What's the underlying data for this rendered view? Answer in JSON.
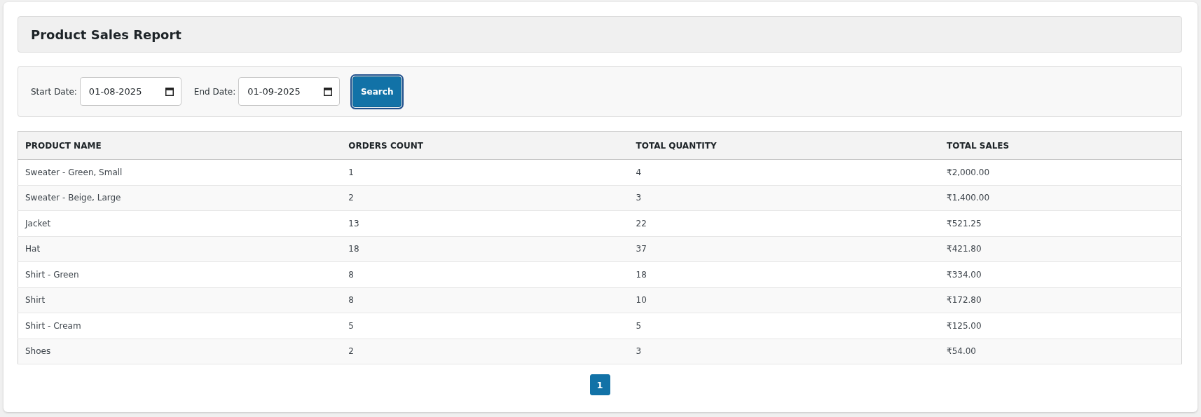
{
  "header": {
    "title": "Product Sales Report"
  },
  "filters": [
    {
      "label": "Start Date:",
      "value": "01-08-2025"
    },
    {
      "label": "End Date:",
      "value": "01-09-2025"
    }
  ],
  "search_button": {
    "label": "Search",
    "focused": true
  },
  "table": {
    "columns": [
      "PRODUCT NAME",
      "ORDERS COUNT",
      "TOTAL QUANTITY",
      "TOTAL SALES"
    ],
    "rows": [
      [
        "Sweater - Green, Small",
        "1",
        "4",
        "₹2,000.00"
      ],
      [
        "Sweater - Beige, Large",
        "2",
        "3",
        "₹1,400.00"
      ],
      [
        "Jacket",
        "13",
        "22",
        "₹521.25"
      ],
      [
        "Hat",
        "18",
        "37",
        "₹421.80"
      ],
      [
        "Shirt - Green",
        "8",
        "18",
        "₹334.00"
      ],
      [
        "Shirt",
        "8",
        "10",
        "₹172.80"
      ],
      [
        "Shirt - Cream",
        "5",
        "5",
        "₹125.00"
      ],
      [
        "Shoes",
        "2",
        "3",
        "₹54.00"
      ]
    ]
  },
  "pagination": [
    {
      "label": "1",
      "selected": true
    }
  ]
}
